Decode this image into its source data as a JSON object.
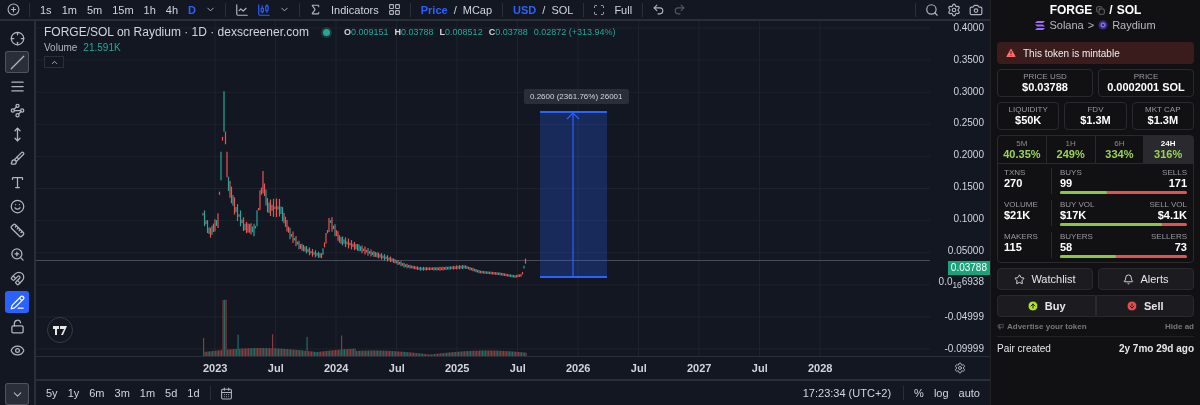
{
  "toolbar": {
    "timeframes": [
      {
        "label": "1s",
        "selected": false
      },
      {
        "label": "1m",
        "selected": false
      },
      {
        "label": "5m",
        "selected": false
      },
      {
        "label": "15m",
        "selected": false
      },
      {
        "label": "1h",
        "selected": false
      },
      {
        "label": "4h",
        "selected": false
      },
      {
        "label": "D",
        "selected": true
      }
    ],
    "chart_types": [
      {
        "kind": "line",
        "selected": false
      },
      {
        "kind": "candles",
        "selected": true
      }
    ],
    "indicators": "Indicators",
    "price_mode": {
      "separator": "/",
      "options": [
        {
          "label": "Price",
          "selected": true
        },
        {
          "label": "MCap",
          "selected": false
        }
      ]
    },
    "currency": {
      "separator": "/",
      "options": [
        {
          "label": "USD",
          "selected": true
        },
        {
          "label": "SOL",
          "selected": false
        }
      ]
    },
    "full": "Full"
  },
  "drawing_tools": [
    {
      "kind": "crosshair",
      "selected": false,
      "active": false
    },
    {
      "kind": "trend",
      "selected": true,
      "active": false
    },
    {
      "kind": "lines",
      "selected": false,
      "active": false
    },
    {
      "kind": "pattern",
      "selected": false,
      "active": false
    },
    {
      "kind": "measure",
      "selected": false,
      "active": false
    },
    {
      "kind": "brush",
      "selected": false,
      "active": false
    },
    {
      "kind": "text",
      "selected": false,
      "active": false
    },
    {
      "kind": "emoji",
      "selected": false,
      "active": false
    },
    {
      "kind": "ruler",
      "selected": false,
      "active": false
    },
    {
      "kind": "zoom",
      "selected": false,
      "active": false
    },
    {
      "kind": "magnet",
      "selected": false,
      "active": false
    },
    {
      "kind": "lock-drawing",
      "selected": false,
      "active": true
    },
    {
      "kind": "lock",
      "selected": false,
      "active": false
    },
    {
      "kind": "eye",
      "selected": false,
      "active": false
    }
  ],
  "legend": {
    "title": "FORGE/SOL on Raydium · 1D · dexscreener.com",
    "ohlc": [
      {
        "key": "O",
        "value": "0.009151"
      },
      {
        "key": "H",
        "value": "0.03788"
      },
      {
        "key": "L",
        "value": "0.008512"
      },
      {
        "key": "C",
        "value": "0.03788"
      }
    ],
    "change": "0.02872 (+313.94%)",
    "volume_label": "Volume",
    "volume_value": "21.591K"
  },
  "chart": {
    "y_labels": [
      "0.4000",
      "0.3500",
      "0.3000",
      "0.2500",
      "0.2000",
      "0.1500",
      "0.1000",
      "0.05000",
      "0.0$_{16}$6938",
      "-0.04999",
      "-0.09999"
    ],
    "x_labels": [
      "2023",
      "Jul",
      "2024",
      "Jul",
      "2025",
      "Jul",
      "2026",
      "Jul",
      "2027",
      "Jul",
      "2028"
    ],
    "last_price": "0.03788",
    "measure_label": "0.2600 (2361.76%) 26001"
  },
  "ranges": [
    "5y",
    "1y",
    "6m",
    "3m",
    "1m",
    "5d",
    "1d"
  ],
  "clock": "17:23:34 (UTC+2)",
  "scale_options": [
    "%",
    "log",
    "auto"
  ],
  "pair": {
    "base": "FORGE",
    "separator": "/",
    "quote": "SOL",
    "chain": "Solana",
    "chevron": ">",
    "dex": "Raydium"
  },
  "alert": "This token is mintable",
  "prices": [
    {
      "label": "PRICE USD",
      "value": "$0.03788"
    },
    {
      "label": "PRICE",
      "value": "0.0002001 SOL"
    }
  ],
  "stats": [
    {
      "label": "LIQUIDITY",
      "value": "$50K"
    },
    {
      "label": "FDV",
      "value": "$1.3M"
    },
    {
      "label": "MKT CAP",
      "value": "$1.3M"
    }
  ],
  "periods": [
    {
      "label": "5M",
      "change": "40.35%",
      "selected": false
    },
    {
      "label": "1H",
      "change": "249%",
      "selected": false
    },
    {
      "label": "6H",
      "change": "334%",
      "selected": false
    },
    {
      "label": "24H",
      "change": "316%",
      "selected": true
    }
  ],
  "activity": [
    {
      "label": "TXNS",
      "value": "270",
      "left_label": "BUYS",
      "left_value": "99",
      "right_label": "SELLS",
      "right_value": "171",
      "level": 0.37
    },
    {
      "label": "VOLUME",
      "value": "$21K",
      "left_label": "BUY VOL",
      "left_value": "$17K",
      "right_label": "SELL VOL",
      "right_value": "$4.1K",
      "level": 0.8
    },
    {
      "label": "MAKERS",
      "value": "115",
      "left_label": "BUYERS",
      "left_value": "58",
      "right_label": "SELLERS",
      "right_value": "73",
      "level": 0.44
    }
  ],
  "actions": [
    {
      "kind": "watchlist",
      "label": "Watchlist"
    },
    {
      "kind": "alerts",
      "label": "Alerts"
    }
  ],
  "trade": [
    {
      "kind": "buy",
      "label": "Buy"
    },
    {
      "kind": "sell",
      "label": "Sell"
    }
  ],
  "ad": {
    "text": "Advertise your token",
    "hide": "Hide ad"
  },
  "pair_created": {
    "label": "Pair created",
    "value": "2y 7mo 29d ago"
  }
}
